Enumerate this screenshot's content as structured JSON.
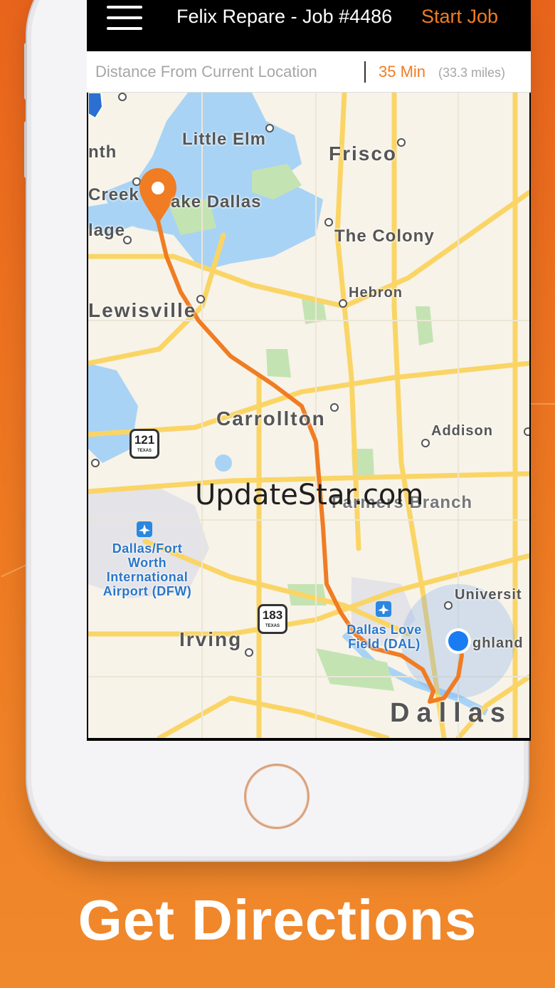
{
  "app_bar": {
    "title": "Felix Repare - Job #4486",
    "start_job_label": "Start Job"
  },
  "info_bar": {
    "label": "Distance From Current Location",
    "time": "35 Min",
    "miles": "(33.3 miles)"
  },
  "map": {
    "places": {
      "little_elm": "Little Elm",
      "frisco": "Frisco",
      "nth": "nth",
      "creek": "Creek",
      "lake_dallas": "ake Dallas",
      "lage": "lage",
      "the_colony": "The Colony",
      "hebron": "Hebron",
      "lewisville": "Lewisville",
      "carrollton": "Carrollton",
      "addison": "Addison",
      "farmers_branch": "Farmers Branch",
      "university": "Universit",
      "highland": "ghland",
      "irving": "Irving",
      "dallas": "Dallas",
      "dfw": "Dallas/Fort Worth International Airport (DFW)",
      "dal": "Dallas Love Field (DAL)"
    },
    "shields": {
      "s121": {
        "number": "121",
        "state": "TEXAS"
      },
      "s183": {
        "number": "183",
        "state": "TEXAS"
      }
    },
    "route_color": "#f07c23",
    "water_color": "#a8d3f5",
    "park_color": "#c4e3b3",
    "road_color": "#fad566"
  },
  "watermark": "UpdateStar.com",
  "caption": "Get Directions"
}
